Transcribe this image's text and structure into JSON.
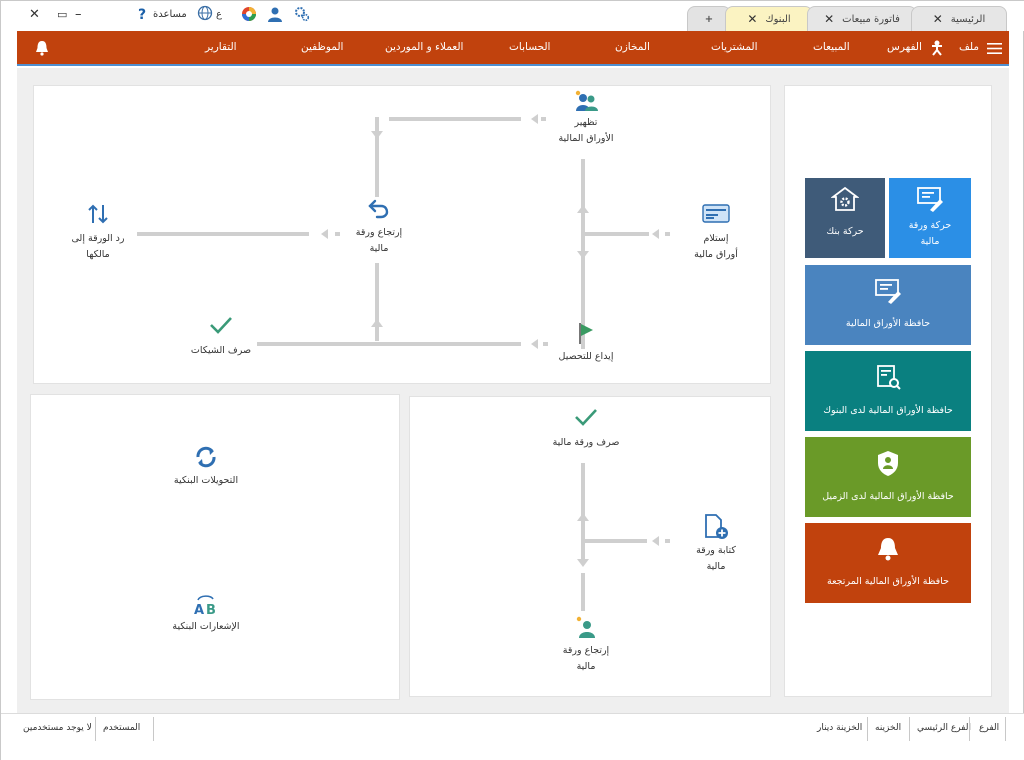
{
  "titlebar": {
    "help_label": "مساعدة",
    "lang_label": "ع",
    "tabs": [
      {
        "label": "الرئيسية"
      },
      {
        "label": "فاتورة مبيعات"
      },
      {
        "label": "البنوك"
      }
    ],
    "new_tab_label": "+"
  },
  "menu": {
    "file_label": "ملف",
    "items": [
      "الفهرس",
      "المبيعات",
      "المشتريات",
      "المخازن",
      "الحسابات",
      "العملاء و الموردين",
      "الموظفين",
      "التقارير"
    ]
  },
  "flow_top": {
    "clearing": {
      "line1": "تظهير",
      "line2": "الأوراق المالية"
    },
    "receive": {
      "line1": "إستلام",
      "line2": "أوراق مالية"
    },
    "deposit": {
      "line1": "إيداع للتحصيل"
    },
    "return_paper": {
      "line1": "إرتجاع ورقة",
      "line2": "مالية"
    },
    "return_owner": {
      "line1": "رد الورقة إلى",
      "line2": "مالكها"
    },
    "cash_cheques": {
      "line1": "صرف الشيكات"
    }
  },
  "flow_bottom": {
    "cash_paper": {
      "line1": "صرف ورقة مالية"
    },
    "write_paper": {
      "line1": "كتابة ورقة",
      "line2": "مالية"
    },
    "return_paper": {
      "line1": "إرتجاع ورقة",
      "line2": "مالية"
    }
  },
  "bank_panel": {
    "transfers": "التحويلات البنكية",
    "notices": "الإشعارات البنكية"
  },
  "tiles": {
    "paper_movement": {
      "line1": "حركة ورقة",
      "line2": "مالية",
      "color": "#2b8fe6"
    },
    "bank_movement": {
      "line1": "حركة بنك",
      "color": "#3f5b79"
    },
    "portfolio": {
      "line1": "حافظة الأوراق المالية",
      "color": "#4a84bf"
    },
    "portfolio_banks": {
      "line1": "حافظة الأوراق المالية لدى البنوك",
      "color": "#0a8080"
    },
    "portfolio_colleagues": {
      "line1": "حافظة الأوراق المالية لدى الزميل",
      "color": "#6a9a28"
    },
    "portfolio_returned": {
      "line1": "حافظة الأوراق المالية المرتجعة",
      "color": "#c1420d"
    }
  },
  "status": {
    "branch_label": "الفرع",
    "branch_value": "الفرع الرئيسي",
    "treasury_label": "الخزينه",
    "treasury_value": "الخزينة دينار",
    "user_label": "المستخدم",
    "user_value": "لا يوجد مستخدمين"
  }
}
